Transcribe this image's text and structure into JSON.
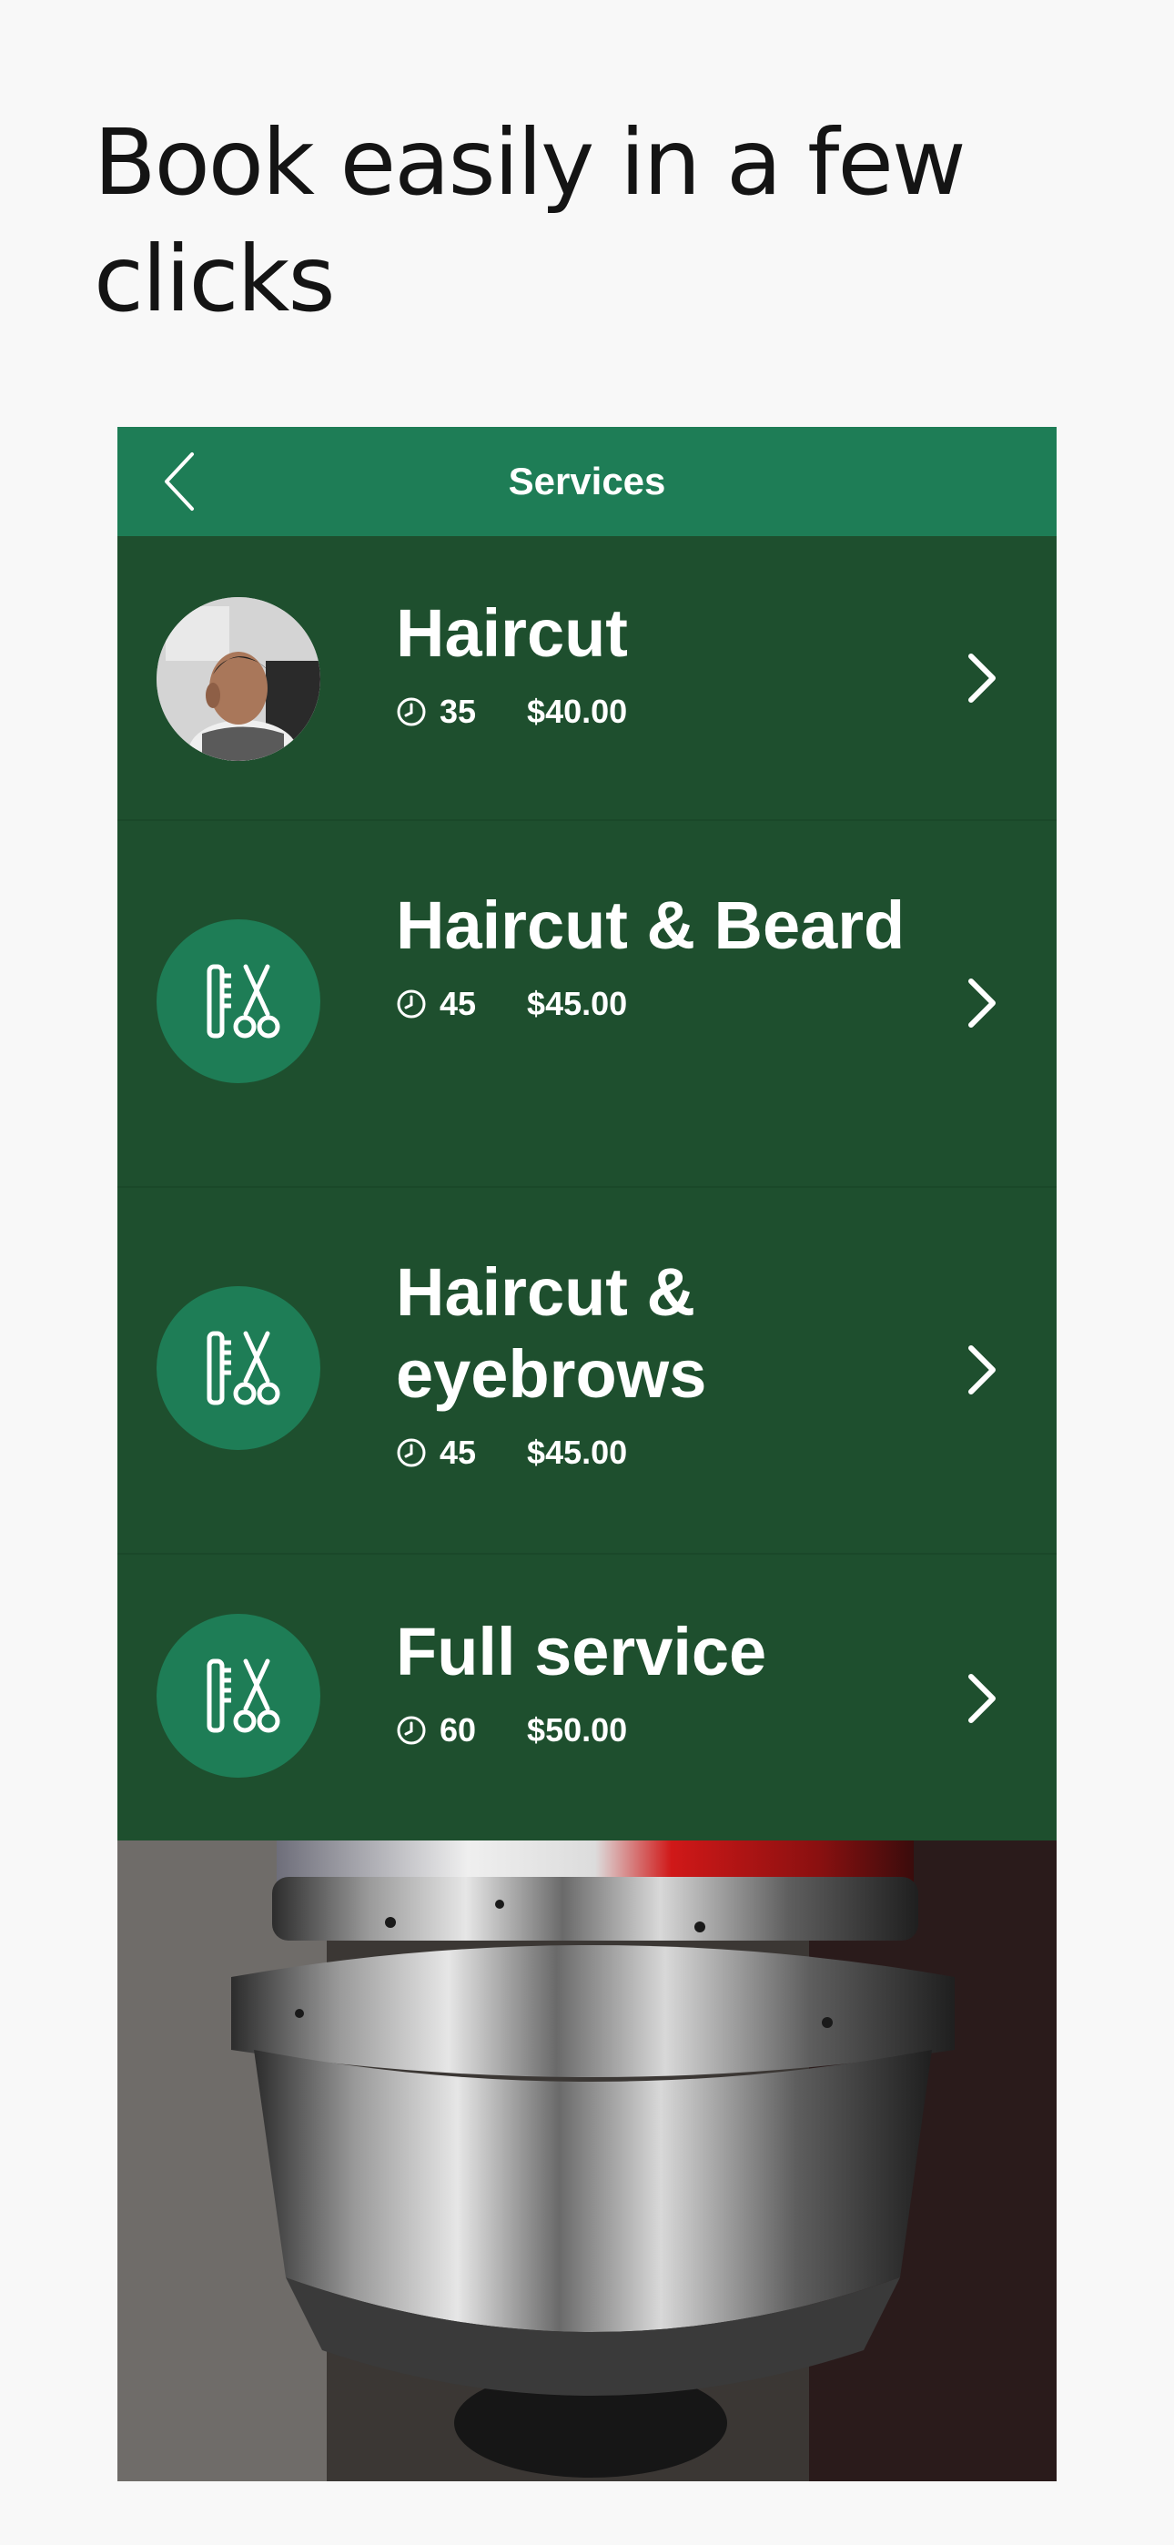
{
  "headline": "Book easily in a few clicks",
  "nav": {
    "title": "Services",
    "back_icon": "chevron-left-icon"
  },
  "services": [
    {
      "name": "Haircut",
      "duration": "35",
      "price": "$40.00",
      "icon": "customer-photo"
    },
    {
      "name": "Haircut & Beard",
      "duration": "45",
      "price": "$45.00",
      "icon": "comb-scissors-icon"
    },
    {
      "name": "Haircut & eyebrows",
      "duration": "45",
      "price": "$45.00",
      "icon": "comb-scissors-icon"
    },
    {
      "name": "Full service",
      "duration": "60",
      "price": "$50.00",
      "icon": "comb-scissors-icon"
    }
  ],
  "colors": {
    "nav_bar": "#1e7d56",
    "list_background": "#1e4f2e",
    "icon_circle": "#1e7d56",
    "text": "#ffffff"
  }
}
